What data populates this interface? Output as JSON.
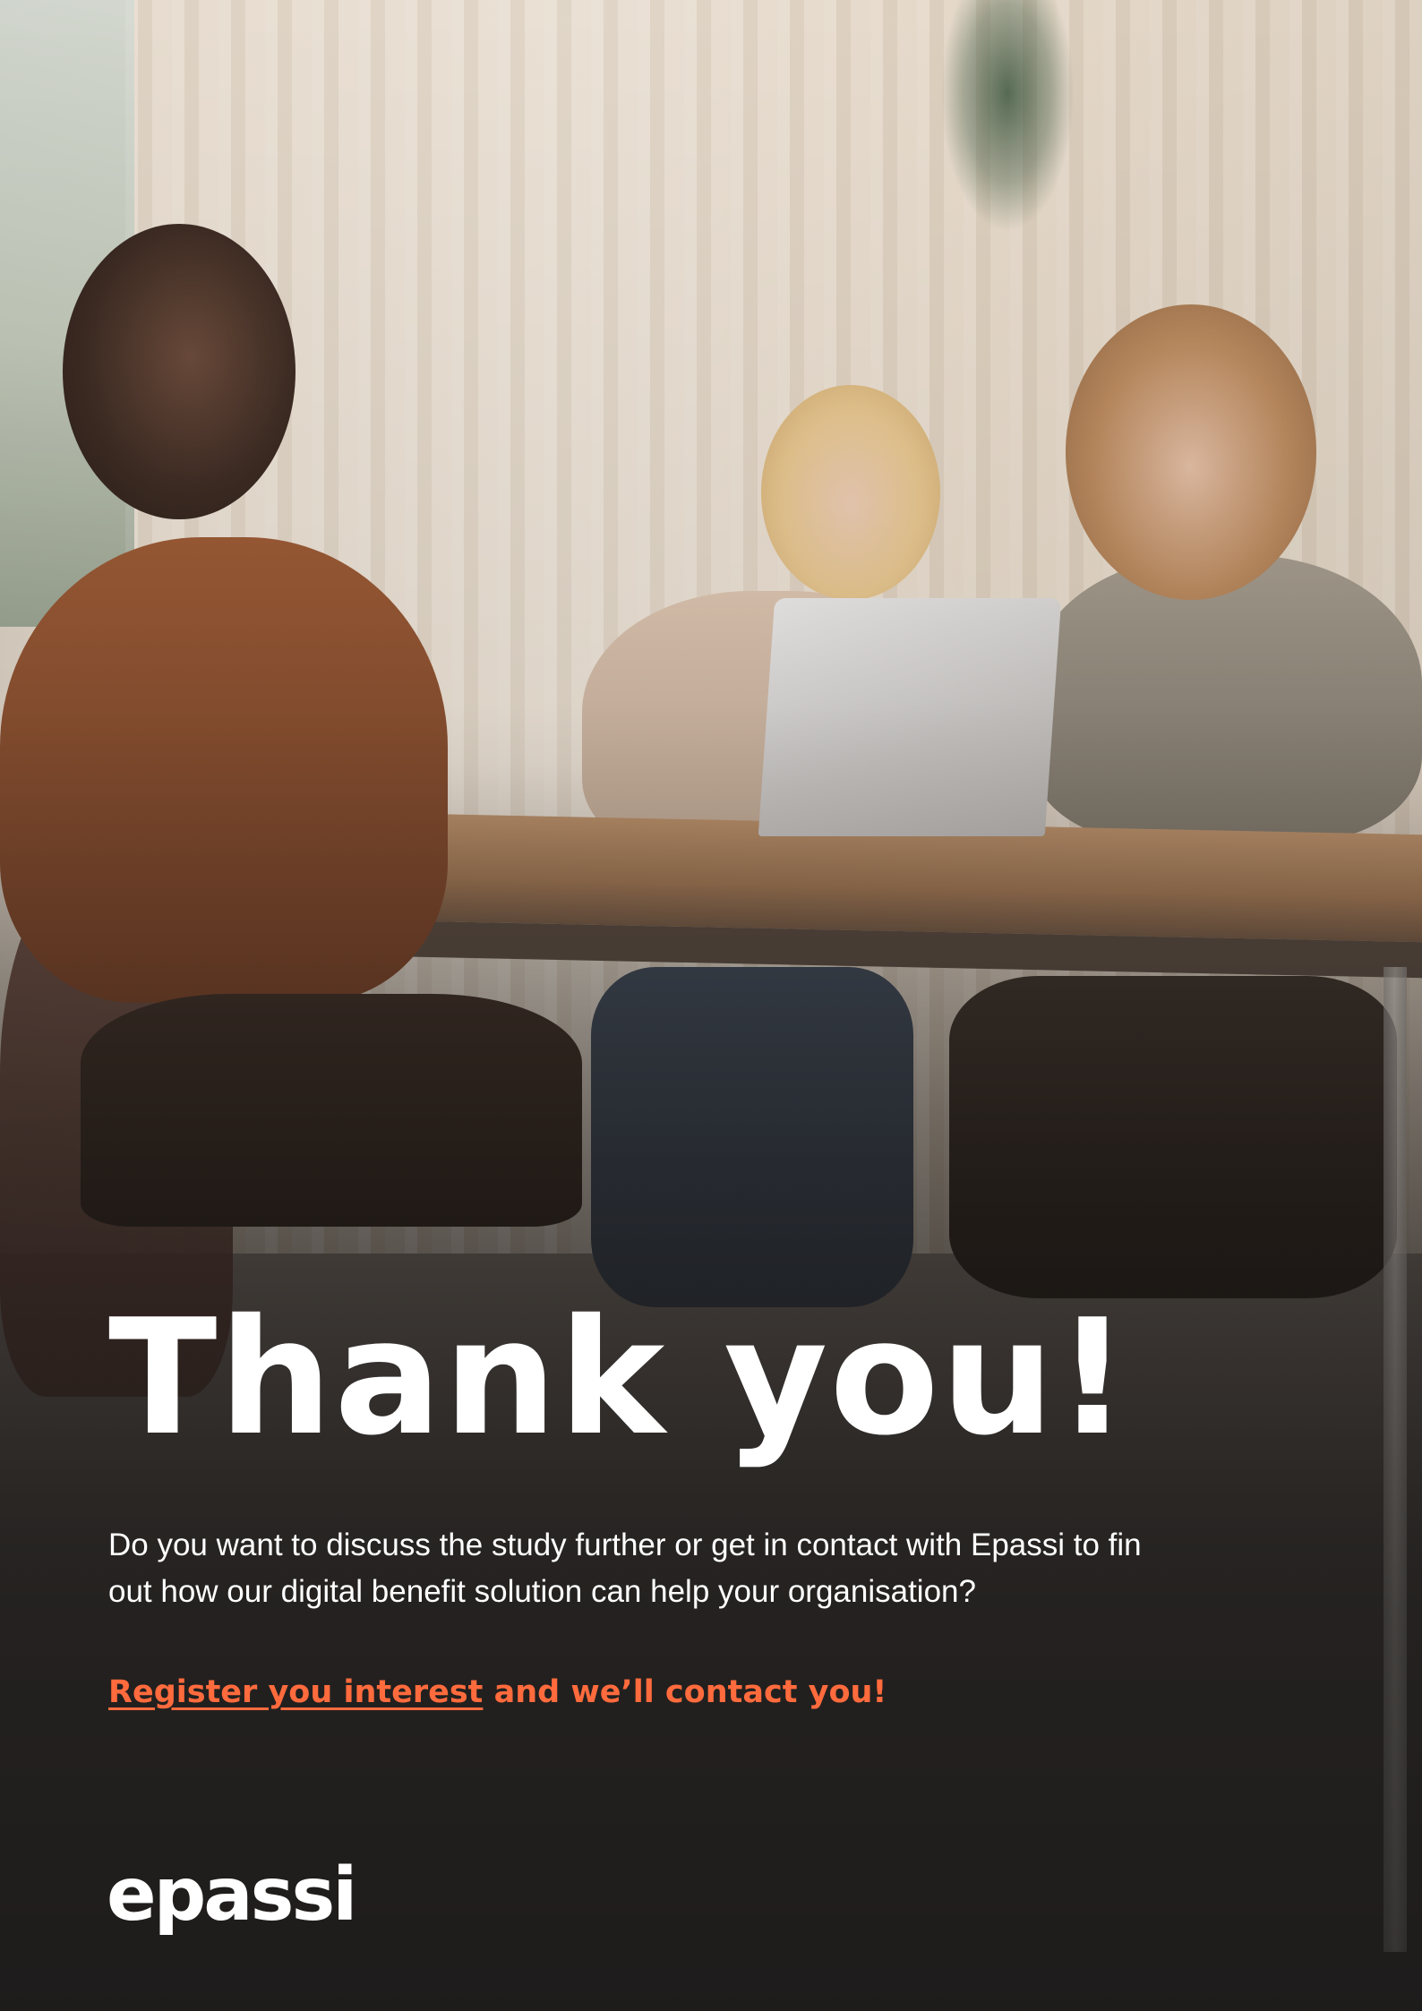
{
  "headline": "Thank you!",
  "body": "Do you want to discuss the study further or get in contact with Epassi to fin out how our digital benefit solution can help your organisation?",
  "cta": {
    "link_text": "Register you interest",
    "rest_text": " and we’ll contact you!"
  },
  "brand": {
    "logo_text": "epassi"
  },
  "colors": {
    "accent": "#ff6b3d",
    "text": "#ffffff"
  }
}
